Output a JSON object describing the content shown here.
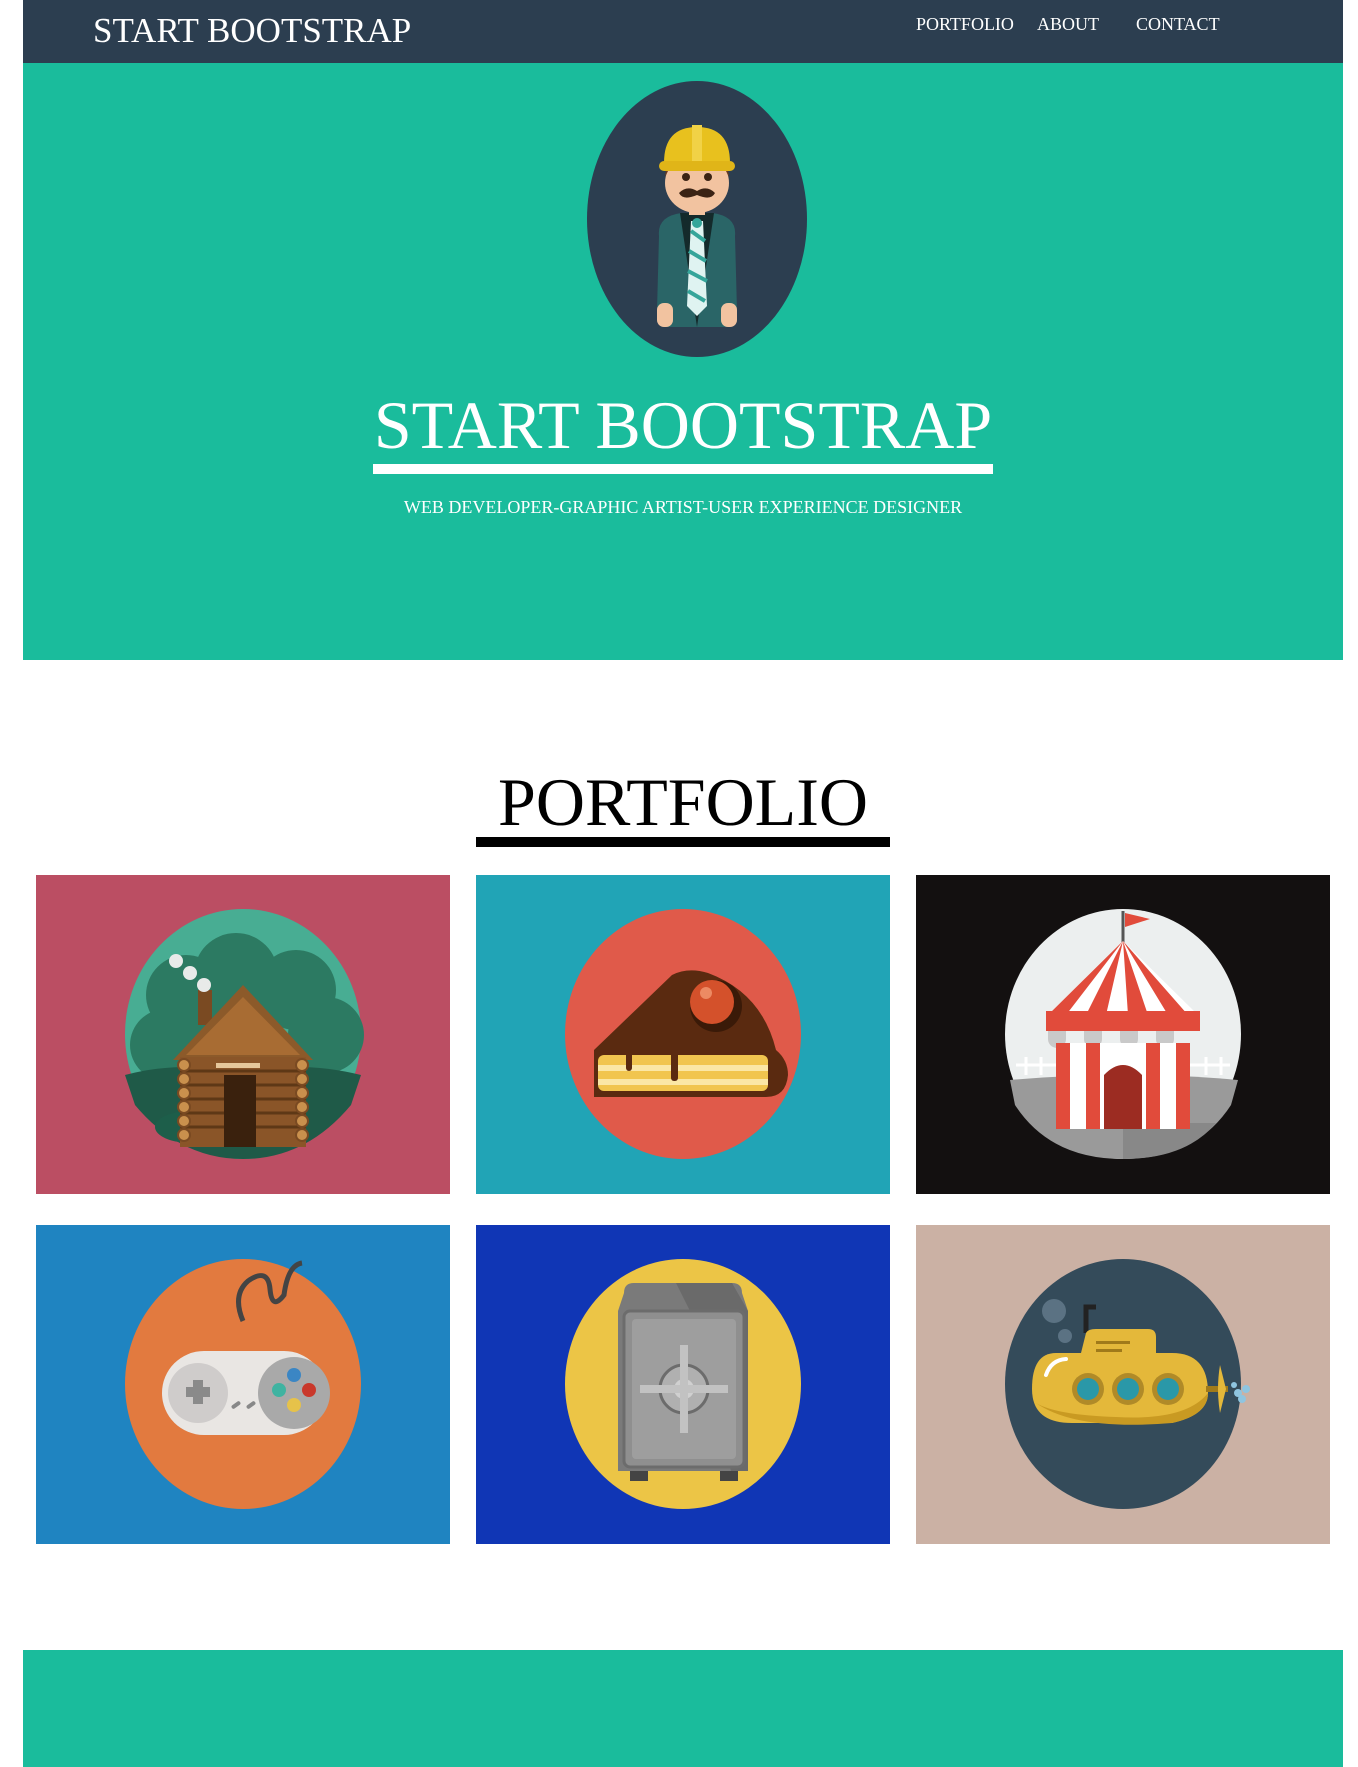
{
  "navbar": {
    "brand": "START BOOTSTRAP",
    "links": [
      "PORTFOLIO",
      "ABOUT",
      "CONTACT"
    ]
  },
  "hero": {
    "title": "START BOOTSTRAP",
    "subtitle": "WEB DEVELOPER-GRAPHIC ARTIST-USER EXPERIENCE DESIGNER",
    "avatar_icon": "construction-worker-avatar-icon"
  },
  "portfolio": {
    "title": "PORTFOLIO",
    "items": [
      {
        "icon": "cabin-icon",
        "bg": "#bb4e63",
        "circle": "#2a8a6f"
      },
      {
        "icon": "cake-icon",
        "bg": "#21a4b6",
        "circle": "#e05a4a"
      },
      {
        "icon": "circus-tent-icon",
        "bg": "#131010",
        "circle": "#ecefef"
      },
      {
        "icon": "game-controller-icon",
        "bg": "#1f84c1",
        "circle": "#e27a3f"
      },
      {
        "icon": "safe-icon",
        "bg": "#1036b5",
        "circle": "#ecc546"
      },
      {
        "icon": "submarine-icon",
        "bg": "#cbb1a4",
        "circle": "#344b5a"
      }
    ]
  },
  "colors": {
    "navbar": "#2c3e50",
    "primary": "#1abc9c"
  }
}
